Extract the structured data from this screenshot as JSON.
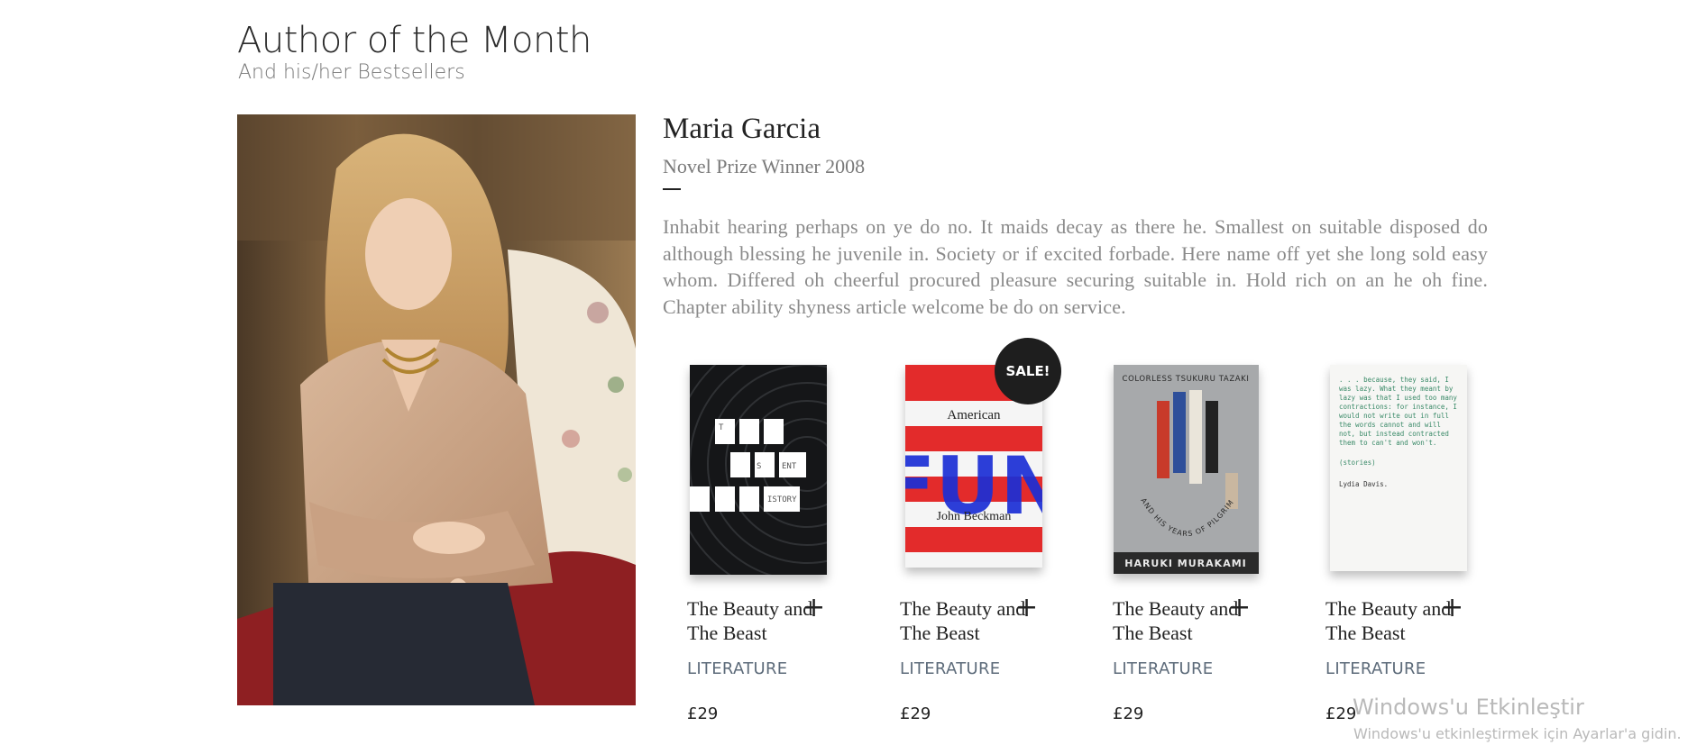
{
  "section": {
    "title": "Author of the Month",
    "subtitle": "And his/her Bestsellers"
  },
  "author": {
    "name": "Maria Garcia",
    "award": "Novel Prize Winner 2008",
    "bio": "Inhabit hearing perhaps on ye do no. It maids decay as there he. Smallest on suitable disposed do although blessing he juvenile in. Society or if excited forbade. Here name off yet she long sold easy whom. Differed oh cheerful procured pleasure securing suitable in. Hold rich on an he oh fine. Chapter ability shyness article welcome be do on service."
  },
  "sale_badge": "SALE!",
  "books": [
    {
      "title_line1": "The Beauty and",
      "title_line2": "The Beast",
      "category": "LITERATURE",
      "price": "£29",
      "cover_text": [
        "T",
        "S",
        "ENT",
        "ISTORY"
      ]
    },
    {
      "title_line1": "The Beauty and",
      "title_line2": "The Beast",
      "category": "LITERATURE",
      "price": "£29",
      "cover_text": [
        "American",
        "FUN",
        "John Beckman"
      ]
    },
    {
      "title_line1": "The Beauty and",
      "title_line2": "The Beast",
      "category": "LITERATURE",
      "price": "£29",
      "cover_text": [
        "COLORLESS TSUKURU TAZAKI",
        "AND HIS YEARS OF PILGRIMAGE",
        "HARUKI MURAKAMI"
      ]
    },
    {
      "title_line1": "The Beauty and",
      "title_line2": "The Beast",
      "category": "LITERATURE",
      "price": "£29",
      "cover_text": [
        ". . . because, they said, I was lazy. What they meant by lazy was that I used too many contractions: for instance, I would not write out in full the words cannot and will not, but instead contracted them to can't and won't.",
        "(stories)",
        "Lydia Davis."
      ]
    }
  ],
  "watermark": {
    "title": "Windows'u Etkinleştir",
    "subtitle": "Windows'u etkinleştirmek için Ayarlar'a gidin."
  },
  "colors": {
    "badge": "#1e1e1e",
    "category": "#5d6b7a",
    "fun_marker": "#1b2fd6",
    "red_stripe": "#e32b2b"
  }
}
